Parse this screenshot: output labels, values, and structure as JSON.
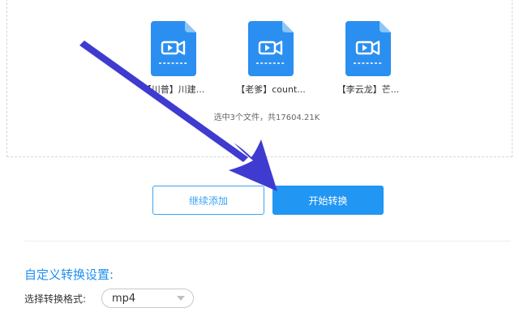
{
  "files": [
    {
      "name": "【川普】川建...",
      "icon": "video-file-icon"
    },
    {
      "name": "【老爹】count...",
      "icon": "video-file-icon"
    },
    {
      "name": "【李云龙】芒...",
      "icon": "video-file-icon"
    }
  ],
  "summary": "选中3个文件，共17604.21K",
  "buttons": {
    "continue_label": "继续添加",
    "start_label": "开始转换"
  },
  "settings": {
    "title": "自定义转换设置:",
    "format_label": "选择转换格式:",
    "format_value": "mp4"
  },
  "colors": {
    "accent": "#2196f3",
    "file_icon": "#2a8ff0",
    "annotation_arrow": "#3f3bd0"
  }
}
